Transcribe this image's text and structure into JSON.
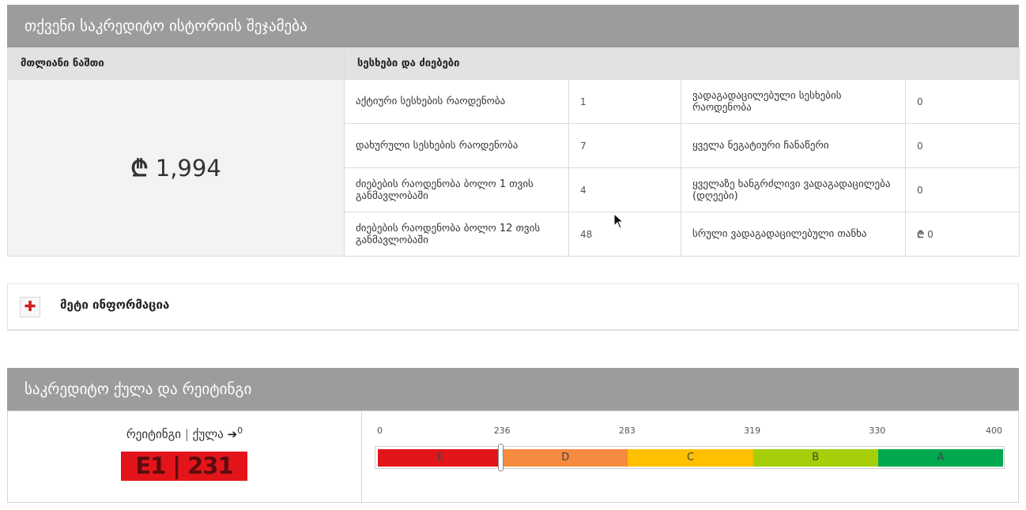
{
  "summary": {
    "title": "თქვენი საკრედიტო ისტორიის შეჯამება",
    "col_total": "მთლიანი ნაშთი",
    "col_loans": "სესხები და ძიებები",
    "currency_symbol": "₾",
    "total_value": "1,994",
    "rows": [
      {
        "l1": "აქტიური სესხების რაოდენობა",
        "v1": "1",
        "l2": "ვადაგადაცილებული სესხების რაოდენობა",
        "v2": "0"
      },
      {
        "l1": "დახურული სესხების რაოდენობა",
        "v1": "7",
        "l2": "ყველა ნეგატიური ჩანაწერი",
        "v2": "0"
      },
      {
        "l1": "ძიებების რაოდენობა ბოლო 1 თვის განმავლობაში",
        "v1": "4",
        "l2": "ყველაზე ხანგრძლივი ვადაგადაცილება (დღეები)",
        "v2": "0"
      },
      {
        "l1": "ძიებების რაოდენობა ბოლო 12 თვის განმავლობაში",
        "v1": "48",
        "l2": "სრული ვადაგადაცილებული თანხა",
        "v2": "0"
      }
    ]
  },
  "more_info": {
    "label": "მეტი ინფორმაცია",
    "icon": "plus-icon"
  },
  "score": {
    "title": "საკრედიტო ქულა და რეიტინგი",
    "label_rating": "რეიტინგი",
    "label_sep": "|",
    "label_score": "ქულა",
    "arrow_icon": "arrow-right-icon",
    "change_value": "0",
    "display": "E1 | 231",
    "score_value": 231,
    "scale_min": 0,
    "scale_max": 400,
    "ticks": [
      "0",
      "236",
      "283",
      "319",
      "330",
      "400"
    ],
    "bands": [
      {
        "label": "E",
        "color": "#e3151a"
      },
      {
        "label": "D",
        "color": "#f68a3f"
      },
      {
        "label": "C",
        "color": "#ffc000"
      },
      {
        "label": "B",
        "color": "#a6cf0a"
      },
      {
        "label": "A",
        "color": "#00a94f"
      }
    ]
  }
}
